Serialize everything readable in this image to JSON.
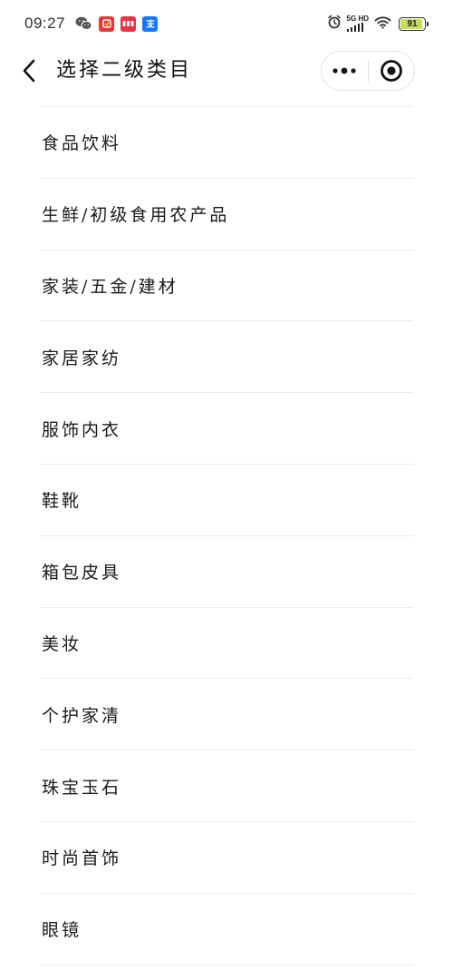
{
  "status_bar": {
    "time": "09:27",
    "network_type": "5G HD",
    "battery_level": "91",
    "battery_fraction": 0.91,
    "icons": [
      "wechat-icon",
      "red-app-icon",
      "red-app-icon-2",
      "blue-app-icon",
      "alarm-icon",
      "signal-icon",
      "wifi-icon",
      "battery-icon"
    ]
  },
  "nav": {
    "title": "选择二级类目",
    "back_icon": "chevron-left-icon",
    "more_icon": "more-dots-icon",
    "close_icon": "target-circle-icon"
  },
  "colors": {
    "divider": "#ebebeb",
    "text": "#1a1a1a",
    "battery": "#c6dc5a",
    "app_red": "#e5383b",
    "app_blue": "#1677ff"
  },
  "categories": [
    {
      "label": "食品饮料"
    },
    {
      "label": "生鲜/初级食用农产品"
    },
    {
      "label": "家装/五金/建材"
    },
    {
      "label": "家居家纺"
    },
    {
      "label": "服饰内衣"
    },
    {
      "label": "鞋靴"
    },
    {
      "label": "箱包皮具"
    },
    {
      "label": "美妆"
    },
    {
      "label": "个护家清"
    },
    {
      "label": "珠宝玉石"
    },
    {
      "label": "时尚首饰"
    },
    {
      "label": "眼镜"
    }
  ]
}
